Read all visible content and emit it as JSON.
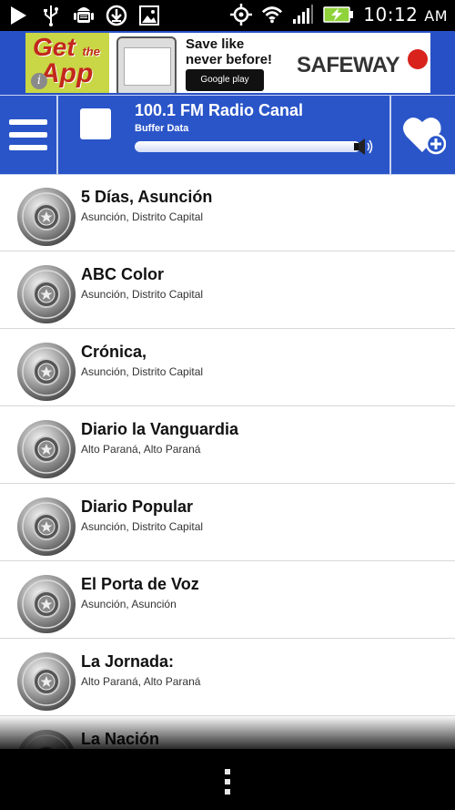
{
  "status_bar": {
    "time": "10:12",
    "ampm": "AM",
    "icons": [
      "play-icon",
      "usb-icon",
      "android-debug-icon",
      "download-icon",
      "image-icon",
      "gps-icon",
      "wifi-icon",
      "signal-icon",
      "battery-charging-icon"
    ]
  },
  "ad": {
    "get": "Get",
    "the": "the",
    "app": "App",
    "save_line1": "Save like",
    "save_line2": "never before!",
    "store_badge": "Google play",
    "brand": "SAFEWAY",
    "info_icon": "info-icon"
  },
  "player": {
    "station_title": "100.1 FM Radio Canal",
    "buffer_label": "Buffer Data",
    "buffer_level": 1.0,
    "accent_color": "#2a55c9"
  },
  "stations": [
    {
      "name": "5 Días, Asunción",
      "city": "Asunción",
      "region": "Distrito Capital"
    },
    {
      "name": "ABC Color",
      "city": "Asunción",
      "region": "Distrito Capital"
    },
    {
      "name": "Crónica,",
      "city": "Asunción",
      "region": "Distrito Capital"
    },
    {
      "name": "Diario la Vanguardia",
      "city": "Alto Paraná",
      "region": "Alto Paraná"
    },
    {
      "name": "Diario Popular",
      "city": "Asunción",
      "region": "Distrito Capital"
    },
    {
      "name": "El Porta de Voz",
      "city": "Asunción",
      "region": "Asunción"
    },
    {
      "name": "La Jornada:",
      "city": "Alto Paraná",
      "region": "Alto Paraná"
    },
    {
      "name": "La Nación",
      "city": "",
      "region": ""
    }
  ]
}
